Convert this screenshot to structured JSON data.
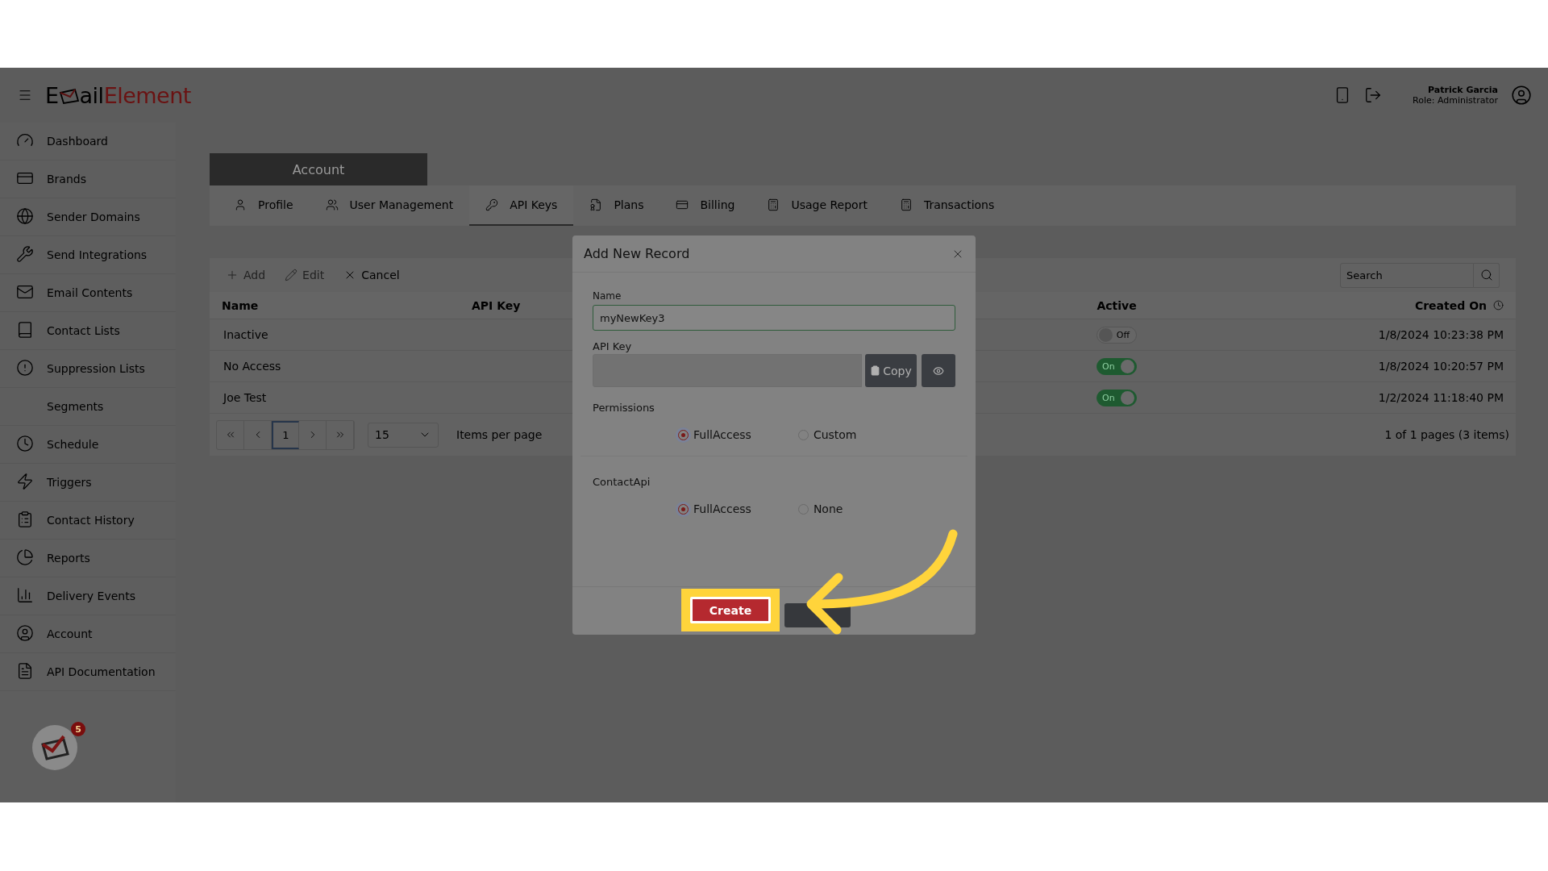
{
  "header": {
    "logo": {
      "prefix": "E",
      "middle": "ail",
      "accent": "Element"
    },
    "user": {
      "name": "Patrick Garcia",
      "role": "Role: Administrator"
    }
  },
  "sidebar": {
    "items": [
      {
        "label": "Dashboard"
      },
      {
        "label": "Brands"
      },
      {
        "label": "Sender Domains"
      },
      {
        "label": "Send Integrations"
      },
      {
        "label": "Email Contents"
      },
      {
        "label": "Contact Lists"
      },
      {
        "label": "Suppression Lists"
      },
      {
        "label": "Segments"
      },
      {
        "label": "Schedule"
      },
      {
        "label": "Triggers"
      },
      {
        "label": "Contact History"
      },
      {
        "label": "Reports"
      },
      {
        "label": "Delivery Events"
      },
      {
        "label": "Account"
      },
      {
        "label": "API Documentation"
      }
    ],
    "badge": "5"
  },
  "page_title": "Account",
  "tabs": [
    {
      "label": "Profile",
      "selected": false
    },
    {
      "label": "User Management",
      "selected": false
    },
    {
      "label": "API Keys",
      "selected": true
    },
    {
      "label": "Plans",
      "selected": false
    },
    {
      "label": "Billing",
      "selected": false
    },
    {
      "label": "Usage Report",
      "selected": false
    },
    {
      "label": "Transactions",
      "selected": false
    }
  ],
  "toolbar": [
    {
      "label": "Add",
      "disabled": true
    },
    {
      "label": "Edit",
      "disabled": true
    },
    {
      "label": "Cancel",
      "disabled": false
    }
  ],
  "search": {
    "placeholder": "Search"
  },
  "table": {
    "columns": [
      "Name",
      "API Key",
      "Active",
      "Created On"
    ],
    "rows": [
      {
        "name": "Inactive",
        "active": {
          "on": false,
          "label": "Off"
        },
        "created": "1/8/2024 10:23:38 PM"
      },
      {
        "name": "No Access",
        "active": {
          "on": true,
          "label": "On"
        },
        "created": "1/8/2024 10:20:57 PM"
      },
      {
        "name": "Joe Test",
        "active": {
          "on": true,
          "label": "On"
        },
        "created": "1/2/2024 11:18:40 PM"
      }
    ]
  },
  "pager": {
    "pages": [
      {
        "label": "1",
        "selected": true
      }
    ],
    "page_size": "15",
    "page_size_label": "Items per page",
    "summary": "1 of 1 pages (3 items)"
  },
  "dialog": {
    "title": "Add New Record",
    "name_label": "Name",
    "name_value": "myNewKey3",
    "key_label": "API Key",
    "copy": "Copy",
    "groups": [
      {
        "label": "Permissions",
        "options": [
          {
            "label": "FullAccess",
            "selected": true
          },
          {
            "label": "Custom",
            "selected": false
          }
        ]
      },
      {
        "label": "ContactApi",
        "options": [
          {
            "label": "FullAccess",
            "selected": true
          },
          {
            "label": "None",
            "selected": false
          }
        ]
      }
    ],
    "create": "Create"
  }
}
